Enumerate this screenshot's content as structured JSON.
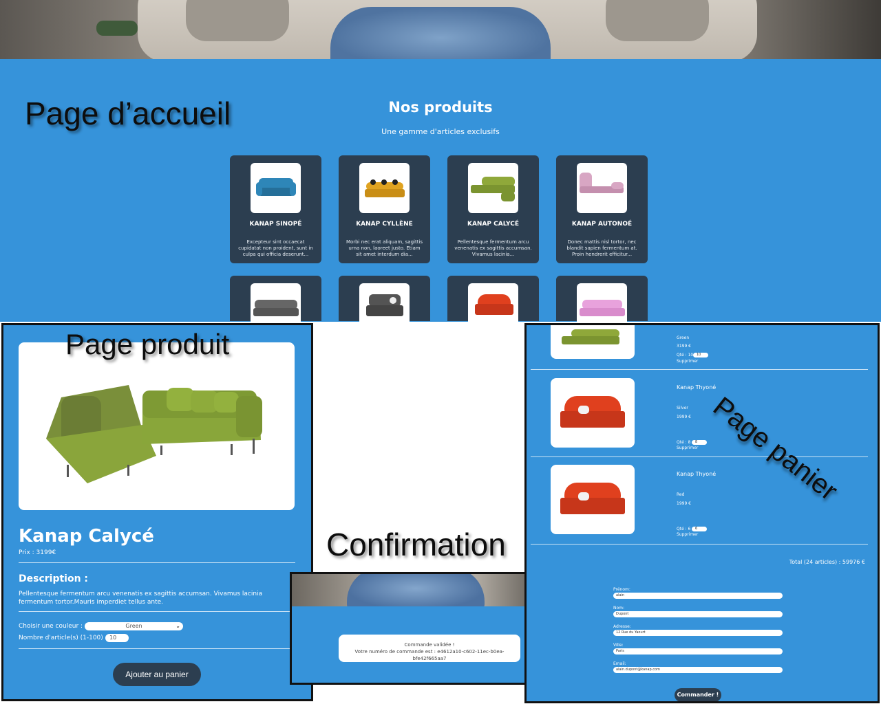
{
  "labels": {
    "home": "Page d’accueil",
    "product": "Page produit",
    "cart": "Page panier",
    "confirmation": "Confirmation"
  },
  "home": {
    "title": "Nos produits",
    "subtitle": "Une gamme d'articles exclusifs",
    "products": [
      {
        "name": "KANAP SINOPÉ",
        "desc": "Excepteur sint occaecat cupidatat non proident, sunt in culpa qui officia deserunt...",
        "color": "#2e86b8"
      },
      {
        "name": "KANAP CYLLÈNE",
        "desc": "Morbi nec erat aliquam, sagittis urna non, laoreet justo. Etiam sit amet interdum dia...",
        "color": "#e0a321"
      },
      {
        "name": "KANAP CALYCÉ",
        "desc": "Pellentesque fermentum arcu venenatis ex sagittis accumsan. Vivamus lacinia...",
        "color": "#8fa83a"
      },
      {
        "name": "KANAP AUTONOÉ",
        "desc": "Donec mattis nisl tortor, nec blandit sapien fermentum at. Proin hendrerit efficitur...",
        "color": "#d8a6c3"
      }
    ],
    "products_row2_colors": [
      "#666666",
      "#545454",
      "#e0401e",
      "#e8a2dc"
    ]
  },
  "product": {
    "name": "Kanap Calycé",
    "price": "Prix : 3199€",
    "description_heading": "Description :",
    "description": "Pellentesque fermentum arcu venenatis ex sagittis accumsan. Vivamus lacinia fermentum tortor.Mauris imperdiet tellus ante.",
    "color_label": "Choisir une couleur :",
    "color_value": "Green",
    "quantity_label": "Nombre d'article(s) (1-100) :",
    "quantity_value": "10",
    "add_button": "Ajouter au panier"
  },
  "cart": {
    "items": [
      {
        "name": "",
        "color": "Green",
        "price": "3199 €",
        "qty_label": "Qté : 10",
        "qty": "10",
        "delete": "Supprimer"
      },
      {
        "name": "Kanap Thyoné",
        "color": "Silver",
        "price": "1999 €",
        "qty_label": "Qté : 8",
        "qty": "8",
        "delete": "Supprimer"
      },
      {
        "name": "Kanap Thyoné",
        "color": "Red",
        "price": "1999 €",
        "qty_label": "Qté : 6",
        "qty": "6",
        "delete": "Supprimer"
      }
    ],
    "total": "Total (24 articles) : 59976 €",
    "form": {
      "firstname_label": "Prénom:",
      "firstname": "alain",
      "lastname_label": "Nom:",
      "lastname": "Dupont",
      "address_label": "Adresse:",
      "address": "12 Rue du Yaourt",
      "city_label": "Ville:",
      "city": "Paris",
      "email_label": "Email:",
      "email": "alain.dupont@kanap.com"
    },
    "order_button": "Commander !"
  },
  "confirmation": {
    "line1": "Commande validée !",
    "line2": "Votre numéro de commande est : e4612a10-c602-11ec-b0ea-bfe42f665aa7"
  },
  "colors": {
    "page_blue": "#3693da",
    "card_dark": "#2c3e50",
    "white": "#ffffff"
  }
}
